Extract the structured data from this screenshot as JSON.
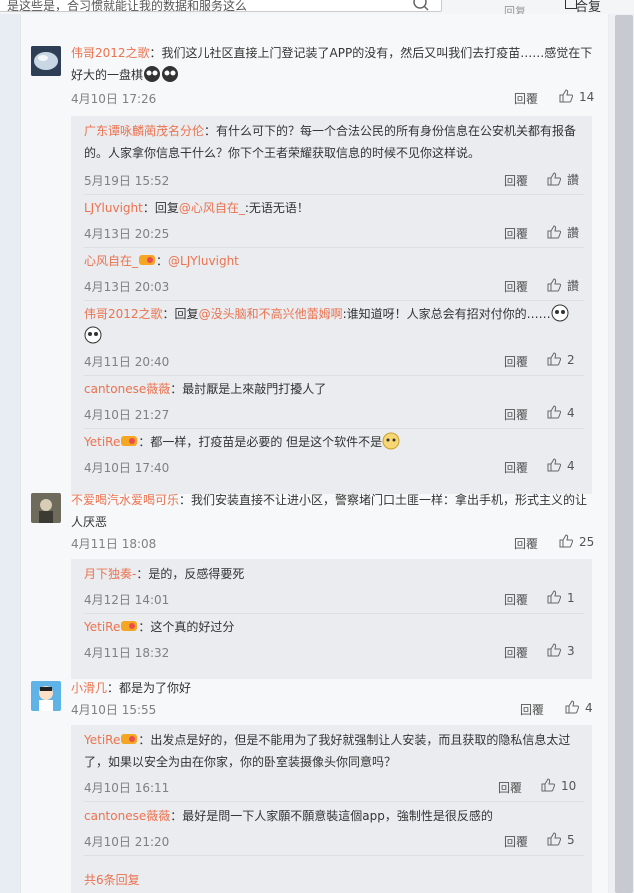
{
  "top": {
    "search_text": "是这些是，合习惯就能让我的数据和服务这么",
    "right_label": "回复",
    "right_tail": "合复"
  },
  "comments": [
    {
      "user": "伟哥2012之歌",
      "text_line1": "：我们这儿社区直接上门登记装了APP的没有，然后又叫我们去打疫苗……感觉在下",
      "text_line2": "好大的一盘棋",
      "time": "4月10日 17:26",
      "reply_label": "回覆",
      "likes": "14",
      "replies": [
        {
          "user": "广东谭咏麟蔺茂名分伦",
          "text_line1": "：有什么可下的？每一个合法公民的所有身份信息在公安机关都有报备",
          "text_line2": "的。人家拿你信息干什么？你下个王者荣耀获取信息的时候不见你这样说。",
          "time": "5月19日 15:52",
          "reply_label": "回覆",
          "likes": "讚"
        },
        {
          "user": "LJYluvight",
          "text_pre": "：回复",
          "mention": "@心风自在_",
          "text_post": ":无语无语！",
          "time": "4月13日 20:25",
          "reply_label": "回覆",
          "likes": "讚"
        },
        {
          "user": "心风自在_",
          "text_pre": "：",
          "mention": "@LJYluvight",
          "text_post": "",
          "time": "4月13日 20:03",
          "reply_label": "回覆",
          "likes": "讚"
        },
        {
          "user": "伟哥2012之歌",
          "text_pre": "：回复",
          "mention": "@没头脑和不高兴他蕾姆啊",
          "text_post": ":谁知道呀！人家总会有招对付你的……",
          "time": "4月11日 20:40",
          "reply_label": "回覆",
          "likes": "2"
        },
        {
          "user": "cantonese薇薇",
          "text_pre": "：最討厭是上來敲門打擾人了",
          "mention": "",
          "text_post": "",
          "time": "4月10日 21:27",
          "reply_label": "回覆",
          "likes": "4"
        },
        {
          "user": "YetiRe",
          "text_pre": "：都一样，打疫苗是必要的 但是这个软件不是",
          "mention": "",
          "text_post": "",
          "time": "4月10日 17:40",
          "reply_label": "回覆",
          "likes": "4"
        }
      ]
    },
    {
      "user": "不爱喝汽水爱喝可乐",
      "text_line1": "：我们安装直接不让进小区，警察堵门口土匪一样：拿出手机，形式主义的让",
      "text_line2": "人厌恶",
      "time": "4月11日 18:08",
      "reply_label": "回覆",
      "likes": "25",
      "replies": [
        {
          "user": "月下独奏-",
          "text_pre": "：是的，反感得要死",
          "time": "4月12日 14:01",
          "reply_label": "回覆",
          "likes": "1"
        },
        {
          "user": "YetiRe",
          "text_pre": "：这个真的好过分",
          "time": "4月11日 18:32",
          "reply_label": "回覆",
          "likes": "3"
        }
      ]
    },
    {
      "user": "小滑几",
      "text_line1": "：都是为了你好",
      "time": "4月10日 15:55",
      "reply_label": "回覆",
      "likes": "4",
      "replies": [
        {
          "user": "YetiRe",
          "text_line1": "：出发点是好的，但是不能用为了我好就强制让人安装，而且获取的隐私信息太过",
          "text_line2": "了，如果以安全为由在你家，你的卧室装摄像头你同意吗？",
          "time": "4月10日 16:11",
          "reply_label": "回覆",
          "likes": "10"
        },
        {
          "user": "cantonese薇薇",
          "text_pre": "：最好是問一下人家願不願意裝這個app，強制性是很反感的",
          "time": "4月10日 21:20",
          "reply_label": "回覆",
          "likes": "5"
        }
      ],
      "more_label": "共6条回复"
    }
  ]
}
